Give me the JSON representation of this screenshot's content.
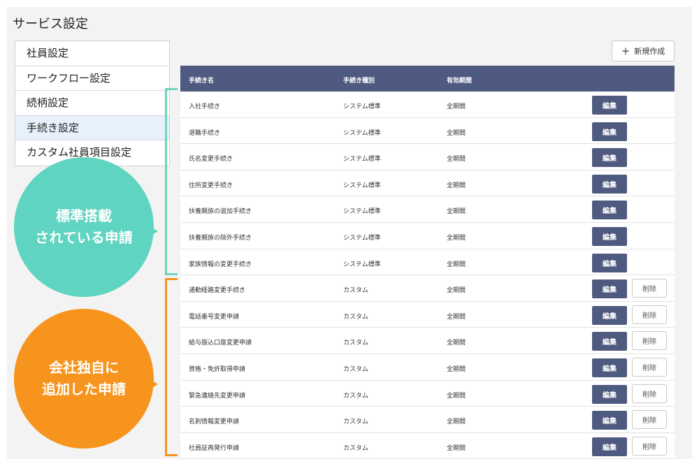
{
  "page_title": "サービス設定",
  "sidebar": {
    "items": [
      {
        "label": "社員設定"
      },
      {
        "label": "ワークフロー設定"
      },
      {
        "label": "続柄設定"
      },
      {
        "label": "手続き設定"
      },
      {
        "label": "カスタム社員項目設定"
      }
    ],
    "active_index": 3
  },
  "toolbar": {
    "new_label": "新規作成",
    "new_icon": "plus-icon"
  },
  "table": {
    "headers": [
      "手続き名",
      "手続き種別",
      "有効期間"
    ],
    "edit_label": "編集",
    "delete_label": "削除",
    "rows": [
      {
        "name": "入社手続き",
        "type": "システム標準",
        "period": "全期間",
        "deletable": false
      },
      {
        "name": "退職手続き",
        "type": "システム標準",
        "period": "全期間",
        "deletable": false
      },
      {
        "name": "氏名変更手続き",
        "type": "システム標準",
        "period": "全期間",
        "deletable": false
      },
      {
        "name": "住所変更手続き",
        "type": "システム標準",
        "period": "全期間",
        "deletable": false
      },
      {
        "name": "扶養親族の追加手続き",
        "type": "システム標準",
        "period": "全期間",
        "deletable": false
      },
      {
        "name": "扶養親族の除外手続き",
        "type": "システム標準",
        "period": "全期間",
        "deletable": false
      },
      {
        "name": "家族情報の変更手続き",
        "type": "システム標準",
        "period": "全期間",
        "deletable": false
      },
      {
        "name": "通勤経路変更手続き",
        "type": "カスタム",
        "period": "全期間",
        "deletable": true
      },
      {
        "name": "電話番号変更申請",
        "type": "カスタム",
        "period": "全期間",
        "deletable": true
      },
      {
        "name": "給与振込口座変更申請",
        "type": "カスタム",
        "period": "全期間",
        "deletable": true
      },
      {
        "name": "資格・免許取得申請",
        "type": "カスタム",
        "period": "全期間",
        "deletable": true
      },
      {
        "name": "緊急連絡先変更申請",
        "type": "カスタム",
        "period": "全期間",
        "deletable": true
      },
      {
        "name": "名刺情報変更申請",
        "type": "カスタム",
        "period": "全期間",
        "deletable": true
      },
      {
        "name": "社員証再発行申請",
        "type": "カスタム",
        "period": "全期間",
        "deletable": true
      }
    ]
  },
  "annotations": {
    "standard": {
      "lines": [
        "標準搭載",
        "されている申請"
      ],
      "color": "#5fd4c0"
    },
    "custom": {
      "lines": [
        "会社独自に",
        "追加した申請"
      ],
      "color": "#f7941d"
    }
  },
  "colors": {
    "header_bg": "#4f5a80",
    "active_menu_bg": "#e7f1fb"
  }
}
